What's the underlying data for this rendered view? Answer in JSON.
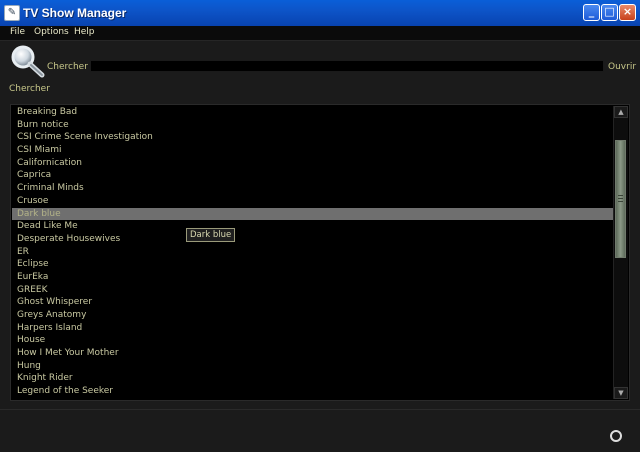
{
  "window": {
    "title": "TV Show Manager",
    "controls": {
      "minimize": "_",
      "maximize": "□",
      "close": "×"
    }
  },
  "menu": {
    "items": [
      "File",
      "Options",
      "Help"
    ]
  },
  "search": {
    "label": "Chercher :",
    "value": "",
    "open_label": "Ouvrir",
    "search_button_label": "Chercher",
    "icon": "magnifier-icon"
  },
  "shows": {
    "items": [
      "Breaking Bad",
      "Burn notice",
      "CSI Crime Scene Investigation",
      "CSI Miami",
      "Californication",
      "Caprica",
      "Criminal Minds",
      "Crusoe",
      "Dark blue",
      "Dead Like Me",
      "Desperate Housewives",
      "ER",
      "Eclipse",
      "EurEka",
      "GREEK",
      "Ghost Whisperer",
      "Greys Anatomy",
      "Harpers Island",
      "House",
      "How I Met Your Mother",
      "Hung",
      "Knight Rider",
      "Legend of the Seeker"
    ],
    "selected": "Dark blue",
    "tooltip": "Dark blue"
  },
  "scrollbar": {
    "up": "▲",
    "down": "▼",
    "position": 0.35
  },
  "colors": {
    "title_bar": "#0d54c8",
    "background": "#1b1b1b",
    "list_background": "#000000",
    "text": "#c9c9a2",
    "selection": "#6f6f6f"
  },
  "status": {
    "icon": "circle-icon"
  }
}
